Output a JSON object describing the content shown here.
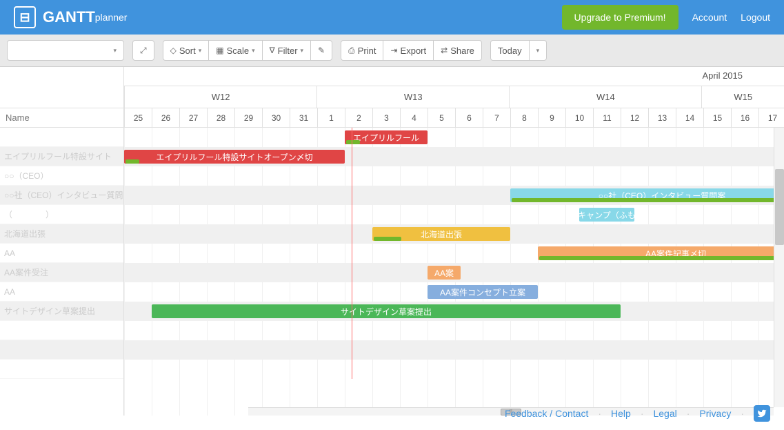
{
  "header": {
    "brand_main": "GANTT",
    "brand_sub": "planner",
    "upgrade_label": "Upgrade to Premium!",
    "account_label": "Account",
    "logout_label": "Logout"
  },
  "toolbar": {
    "sort_label": "Sort",
    "scale_label": "Scale",
    "filter_label": "Filter",
    "print_label": "Print",
    "export_label": "Export",
    "share_label": "Share",
    "today_label": "Today"
  },
  "sidebar": {
    "name_header": "Name",
    "rows": [
      "",
      "エイプリルフール特設サイト",
      "○○（CEO）",
      "○○社（CEO）インタビュー質問",
      "（　　　　）",
      "北海道出張",
      "AA",
      "AA案件受注",
      "AA",
      "サイトデザイン草案提出",
      "",
      "",
      ""
    ]
  },
  "timeline": {
    "month_label": "April 2015",
    "weeks": [
      "W12",
      "W13",
      "W14",
      "W15"
    ],
    "days": [
      "25",
      "26",
      "27",
      "28",
      "29",
      "30",
      "31",
      "1",
      "2",
      "3",
      "4",
      "5",
      "6",
      "7",
      "8",
      "9",
      "10",
      "11",
      "12",
      "13",
      "14",
      "15",
      "16",
      "17"
    ]
  },
  "bars": [
    {
      "row": 0,
      "start": 8,
      "span": 3,
      "color": "#e04545",
      "label": "エイプリルフール",
      "sub_color": "#72b72c",
      "sub_span": 0.5
    },
    {
      "row": 1,
      "start": 0,
      "span": 8,
      "color": "#e04545",
      "label": "エイプリルフール特設サイトオープン〆切",
      "sub_color": "#72b72c",
      "sub_span": 0.5
    },
    {
      "row": 3,
      "start": 14,
      "span": 11,
      "color": "#88d8e8",
      "label": "○○社（CEO）インタビュー質問案",
      "sub_color": "#72b72c",
      "sub_span": 11
    },
    {
      "row": 4,
      "start": 16.5,
      "span": 2,
      "color": "#88d8e8",
      "label": "キャンプ（ふも",
      "sub_color": null
    },
    {
      "row": 5,
      "start": 9,
      "span": 5,
      "color": "#f0c040",
      "label": "北海道出張",
      "sub_color": "#72b72c",
      "sub_span": 1
    },
    {
      "row": 6,
      "start": 15,
      "span": 10,
      "color": "#f5a96a",
      "label": "AA案件記事〆切",
      "sub_color": "#72b72c",
      "sub_span": 10
    },
    {
      "row": 7,
      "start": 11,
      "span": 1.2,
      "color": "#f5a96a",
      "label": "AA案",
      "sub_color": null
    },
    {
      "row": 8,
      "start": 11,
      "span": 4,
      "color": "#86aede",
      "label": "AA案件コンセプト立案",
      "sub_color": null
    },
    {
      "row": 9,
      "start": 1,
      "span": 17,
      "color": "#4bb758",
      "label": "サイトデザイン草案提出",
      "sub_color": null
    }
  ],
  "footer": {
    "feedback": "Feedback / Contact",
    "help": "Help",
    "legal": "Legal",
    "privacy": "Privacy"
  }
}
